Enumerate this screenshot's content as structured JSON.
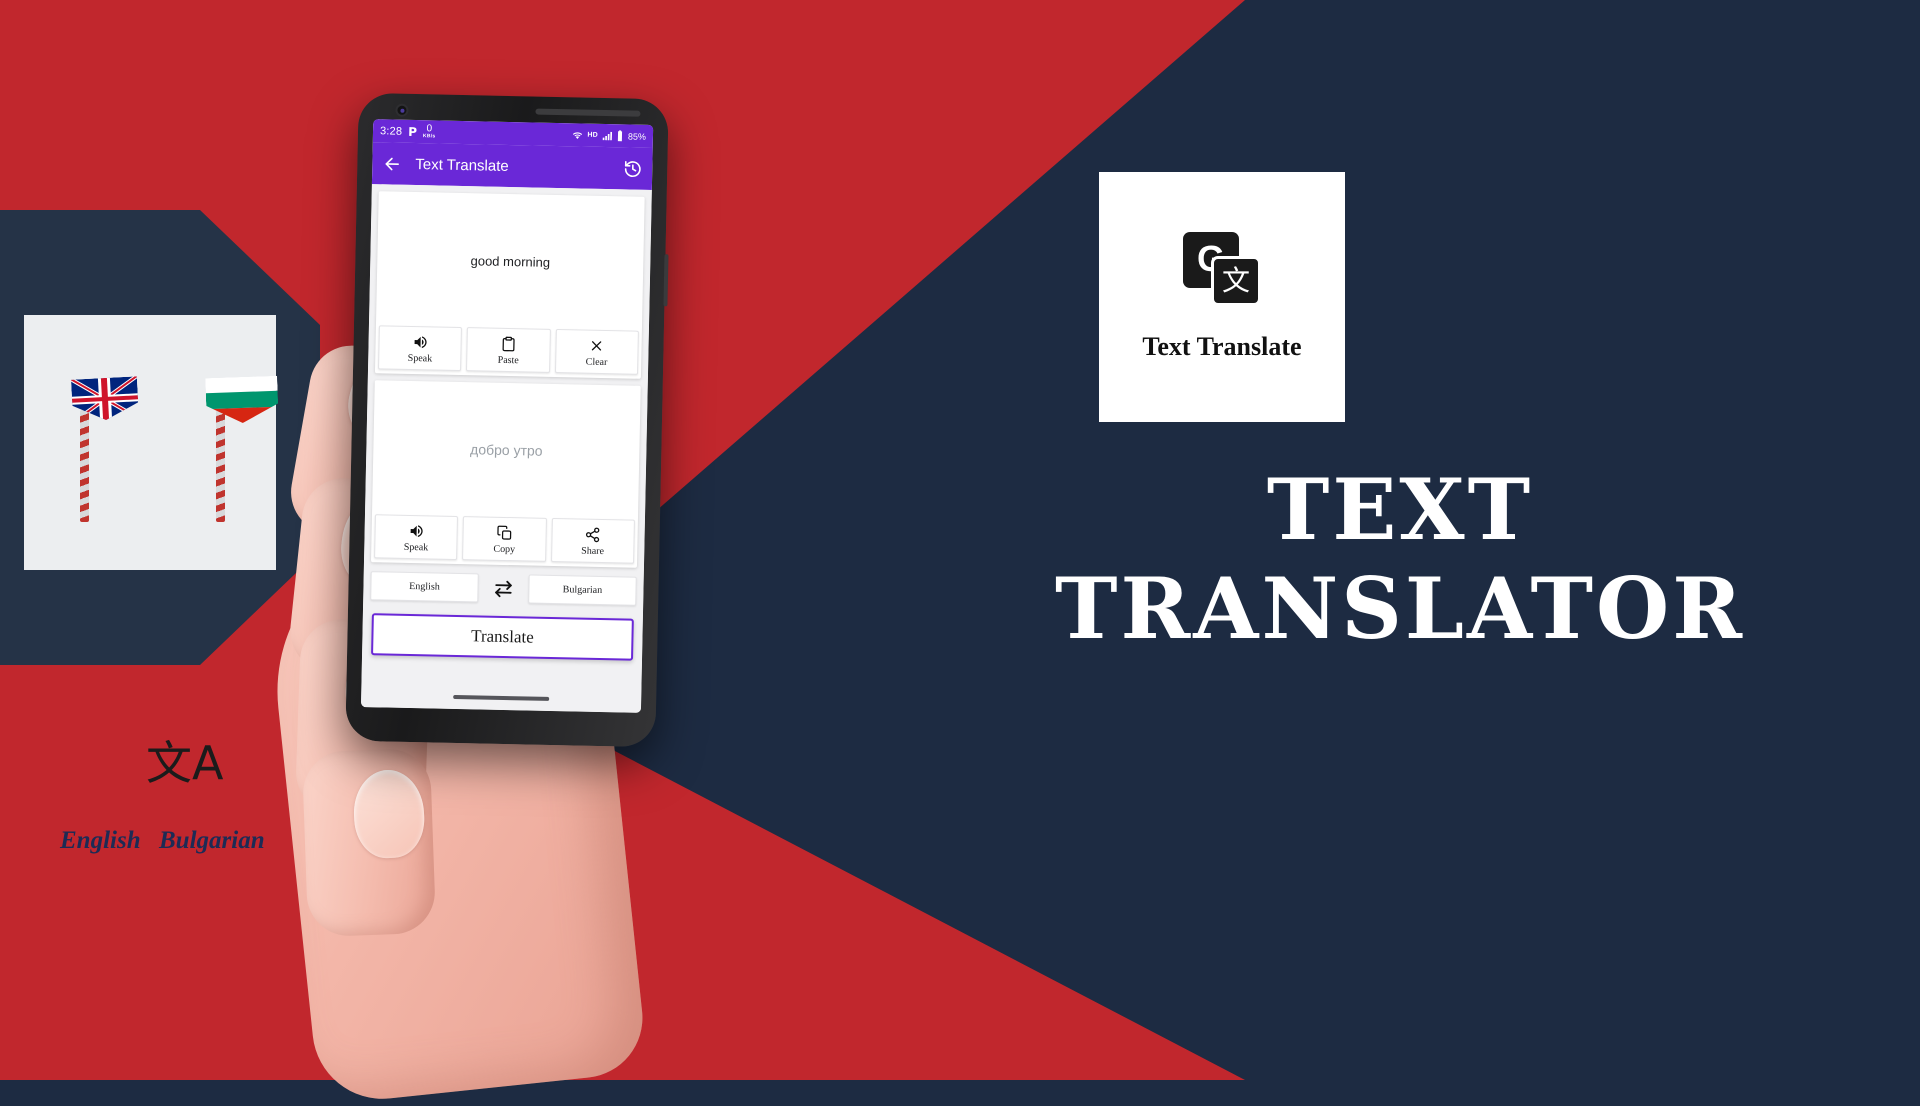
{
  "theme": {
    "red": "#c1272d",
    "navy": "#1d2b42",
    "purple": "#6a28d7",
    "card_white": "#ffffff"
  },
  "flag_card": {
    "source_language": "English",
    "target_language": "Bulgarian",
    "translate_glyph": "文A",
    "source_flag": "united-kingdom",
    "target_flag": "bulgaria"
  },
  "phone": {
    "statusbar": {
      "time": "3:28",
      "app_indicator": "P",
      "network_speed_value": "0",
      "network_speed_unit": "KB/s",
      "hd_label": "HD",
      "battery": "85%"
    },
    "appbar": {
      "back_icon": "arrow-left-icon",
      "title": "Text Translate",
      "history_icon": "history-icon"
    },
    "source_card": {
      "text": "good morning",
      "buttons": [
        {
          "label": "Speak",
          "icon": "volume-up-icon"
        },
        {
          "label": "Paste",
          "icon": "clipboard-icon"
        },
        {
          "label": "Clear",
          "icon": "close-icon"
        }
      ]
    },
    "target_card": {
      "text": "добро утро",
      "buttons": [
        {
          "label": "Speak",
          "icon": "volume-up-icon"
        },
        {
          "label": "Copy",
          "icon": "copy-icon"
        },
        {
          "label": "Share",
          "icon": "share-icon"
        }
      ]
    },
    "language_row": {
      "source": "English",
      "swap_icon": "swap-horizontal-icon",
      "target": "Bulgarian"
    },
    "translate_button": "Translate"
  },
  "app_icon_card": {
    "icon_back_letter": "G",
    "icon_front_glyph": "文",
    "label": "Text Translate"
  },
  "promo_title": {
    "line1": "TEXT",
    "line2": "TRANSLATOR"
  }
}
